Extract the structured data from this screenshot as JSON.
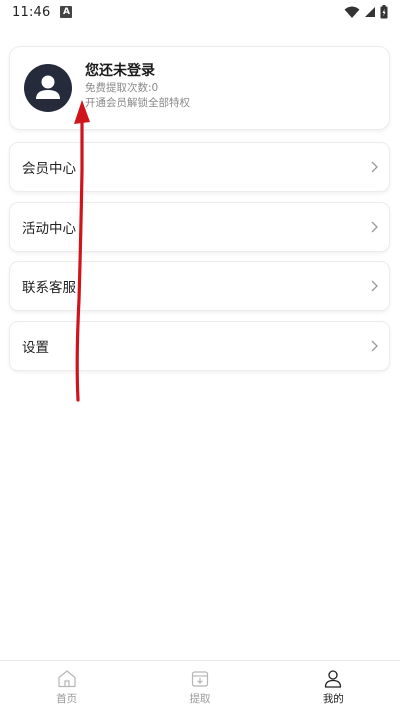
{
  "status_bar": {
    "time": "11:46",
    "notification_icon_letter": "A"
  },
  "profile": {
    "title": "您还未登录",
    "free_extractions": "免费提取次数:0",
    "upgrade_hint": "开通会员解锁全部特权"
  },
  "menu": {
    "items": [
      {
        "label": "会员中心"
      },
      {
        "label": "活动中心"
      },
      {
        "label": "联系客服"
      },
      {
        "label": "设置"
      }
    ]
  },
  "bottom_nav": {
    "items": [
      {
        "label": "首页",
        "icon": "home-icon",
        "active": false
      },
      {
        "label": "提取",
        "icon": "download-box-icon",
        "active": false
      },
      {
        "label": "我的",
        "icon": "user-icon",
        "active": true
      }
    ]
  },
  "colors": {
    "annotation": "#d0141b",
    "avatar_bg": "#262b3c"
  }
}
